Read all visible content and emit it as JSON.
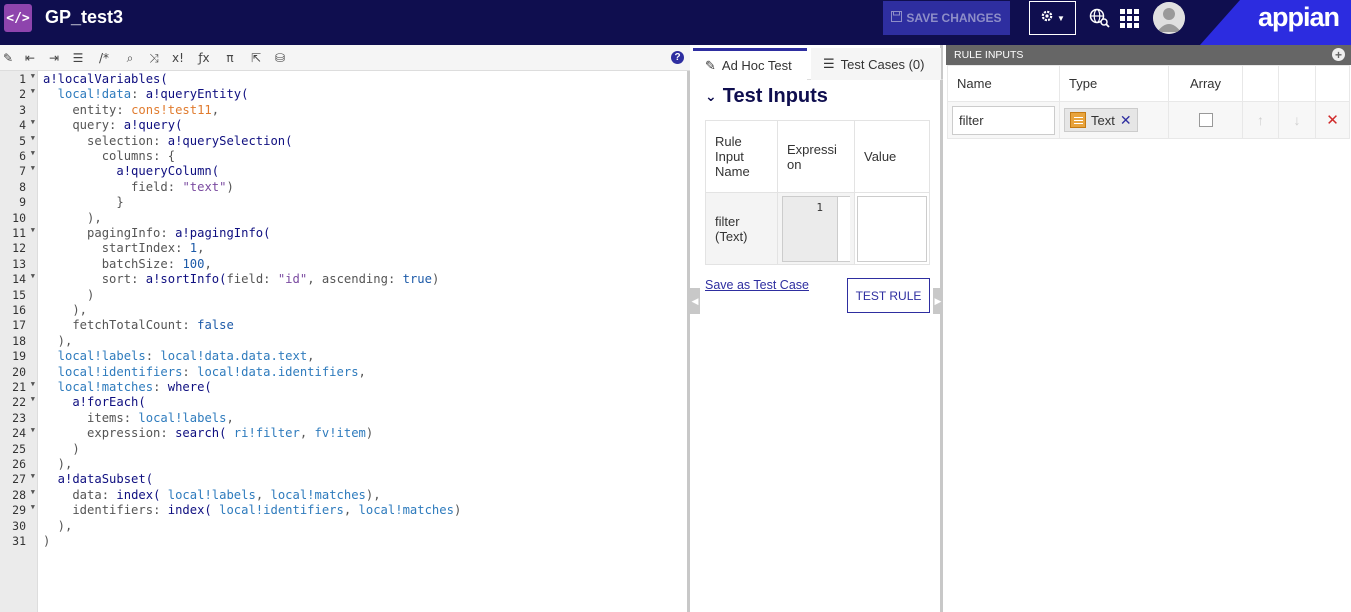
{
  "header": {
    "logo_glyph": "</>",
    "title": "GP_test3",
    "save_label": "SAVE CHANGES",
    "brand": "appian",
    "accent_color": "#0f0e4f"
  },
  "editor": {
    "help_glyph": "?",
    "line_numbers": [
      "1",
      "2",
      "3",
      "4",
      "5",
      "6",
      "7",
      "8",
      "9",
      "10",
      "11",
      "12",
      "13",
      "14",
      "15",
      "16",
      "17",
      "18",
      "19",
      "20",
      "21",
      "22",
      "23",
      "24",
      "25",
      "26",
      "27",
      "28",
      "29",
      "30",
      "31"
    ],
    "folds": [
      "1",
      "2",
      "4",
      "5",
      "6",
      "7",
      "11",
      "14",
      "21",
      "22",
      "24",
      "27",
      "28",
      "29"
    ],
    "lines": [
      [
        {
          "t": "a!localVariables(",
          "c": "fn"
        }
      ],
      [
        {
          "t": "  local!data",
          "c": "var"
        },
        {
          "t": ": ",
          "c": "kw"
        },
        {
          "t": "a!queryEntity(",
          "c": "fn"
        }
      ],
      [
        {
          "t": "    entity",
          "c": "prm"
        },
        {
          "t": ": ",
          "c": "kw"
        },
        {
          "t": "cons!test11",
          "c": "cst"
        },
        {
          "t": ",",
          "c": "kw"
        }
      ],
      [
        {
          "t": "    query",
          "c": "prm"
        },
        {
          "t": ": ",
          "c": "kw"
        },
        {
          "t": "a!query(",
          "c": "fn"
        }
      ],
      [
        {
          "t": "      selection",
          "c": "prm"
        },
        {
          "t": ": ",
          "c": "kw"
        },
        {
          "t": "a!querySelection(",
          "c": "fn"
        }
      ],
      [
        {
          "t": "        columns",
          "c": "prm"
        },
        {
          "t": ": {",
          "c": "kw"
        }
      ],
      [
        {
          "t": "          a!queryColumn(",
          "c": "fn"
        }
      ],
      [
        {
          "t": "            field",
          "c": "prm"
        },
        {
          "t": ": ",
          "c": "kw"
        },
        {
          "t": "\"text\"",
          "c": "str"
        },
        {
          "t": ")",
          "c": "kw"
        }
      ],
      [
        {
          "t": "          }",
          "c": "kw"
        }
      ],
      [
        {
          "t": "      ),",
          "c": "kw"
        }
      ],
      [
        {
          "t": "      pagingInfo",
          "c": "prm"
        },
        {
          "t": ": ",
          "c": "kw"
        },
        {
          "t": "a!pagingInfo(",
          "c": "fn"
        }
      ],
      [
        {
          "t": "        startIndex",
          "c": "prm"
        },
        {
          "t": ": ",
          "c": "kw"
        },
        {
          "t": "1",
          "c": "num"
        },
        {
          "t": ",",
          "c": "kw"
        }
      ],
      [
        {
          "t": "        batchSize",
          "c": "prm"
        },
        {
          "t": ": ",
          "c": "kw"
        },
        {
          "t": "100",
          "c": "num"
        },
        {
          "t": ",",
          "c": "kw"
        }
      ],
      [
        {
          "t": "        sort",
          "c": "prm"
        },
        {
          "t": ": ",
          "c": "kw"
        },
        {
          "t": "a!sortInfo(",
          "c": "fn"
        },
        {
          "t": "field",
          "c": "prm"
        },
        {
          "t": ": ",
          "c": "kw"
        },
        {
          "t": "\"id\"",
          "c": "str"
        },
        {
          "t": ", ",
          "c": "kw"
        },
        {
          "t": "ascending",
          "c": "prm"
        },
        {
          "t": ": ",
          "c": "kw"
        },
        {
          "t": "true",
          "c": "bool"
        },
        {
          "t": ")",
          "c": "kw"
        }
      ],
      [
        {
          "t": "      )",
          "c": "kw"
        }
      ],
      [
        {
          "t": "    ),",
          "c": "kw"
        }
      ],
      [
        {
          "t": "    fetchTotalCount",
          "c": "prm"
        },
        {
          "t": ": ",
          "c": "kw"
        },
        {
          "t": "false",
          "c": "bool"
        }
      ],
      [
        {
          "t": "  ),",
          "c": "kw"
        }
      ],
      [
        {
          "t": "  local!labels",
          "c": "var"
        },
        {
          "t": ": ",
          "c": "kw"
        },
        {
          "t": "local!data.data.text",
          "c": "var"
        },
        {
          "t": ",",
          "c": "kw"
        }
      ],
      [
        {
          "t": "  local!identifiers",
          "c": "var"
        },
        {
          "t": ": ",
          "c": "kw"
        },
        {
          "t": "local!data.identifiers",
          "c": "var"
        },
        {
          "t": ",",
          "c": "kw"
        }
      ],
      [
        {
          "t": "  local!matches",
          "c": "var"
        },
        {
          "t": ": ",
          "c": "kw"
        },
        {
          "t": "where(",
          "c": "fn"
        }
      ],
      [
        {
          "t": "    a!forEach(",
          "c": "fn"
        }
      ],
      [
        {
          "t": "      items",
          "c": "prm"
        },
        {
          "t": ": ",
          "c": "kw"
        },
        {
          "t": "local!labels",
          "c": "var"
        },
        {
          "t": ",",
          "c": "kw"
        }
      ],
      [
        {
          "t": "      expression",
          "c": "prm"
        },
        {
          "t": ": ",
          "c": "kw"
        },
        {
          "t": "search(",
          "c": "fn"
        },
        {
          "t": " ri!filter",
          "c": "var"
        },
        {
          "t": ", ",
          "c": "kw"
        },
        {
          "t": "fv!item",
          "c": "var"
        },
        {
          "t": ")",
          "c": "kw"
        }
      ],
      [
        {
          "t": "    )",
          "c": "kw"
        }
      ],
      [
        {
          "t": "  ),",
          "c": "kw"
        }
      ],
      [
        {
          "t": "  a!dataSubset(",
          "c": "fn"
        }
      ],
      [
        {
          "t": "    data",
          "c": "prm"
        },
        {
          "t": ": ",
          "c": "kw"
        },
        {
          "t": "index(",
          "c": "fn"
        },
        {
          "t": " local!labels",
          "c": "var"
        },
        {
          "t": ", ",
          "c": "kw"
        },
        {
          "t": "local!matches",
          "c": "var"
        },
        {
          "t": "),",
          "c": "kw"
        }
      ],
      [
        {
          "t": "    identifiers",
          "c": "prm"
        },
        {
          "t": ": ",
          "c": "kw"
        },
        {
          "t": "index(",
          "c": "fn"
        },
        {
          "t": " local!identifiers",
          "c": "var"
        },
        {
          "t": ", ",
          "c": "kw"
        },
        {
          "t": "local!matches",
          "c": "var"
        },
        {
          "t": ")",
          "c": "kw"
        }
      ],
      [
        {
          "t": "  ),",
          "c": "kw"
        }
      ],
      [
        {
          "t": ")",
          "c": "kw"
        }
      ]
    ]
  },
  "test_panel": {
    "tabs": [
      {
        "label": "Ad Hoc Test",
        "active": true
      },
      {
        "label": "Test Cases (0)",
        "active": false
      }
    ],
    "section_title": "Test Inputs",
    "columns": [
      "Rule Input Name",
      "Expressi on",
      "Value"
    ],
    "rows": [
      {
        "name": "filter (Text)",
        "expression_line": "1"
      }
    ],
    "save_link": "Save as Test Case",
    "test_rule_button": "TEST RULE"
  },
  "rule_inputs": {
    "header": "RULE INPUTS",
    "columns": [
      "Name",
      "Type",
      "Array"
    ],
    "rows": [
      {
        "name": "filter",
        "type": "Text",
        "array": false
      }
    ]
  }
}
